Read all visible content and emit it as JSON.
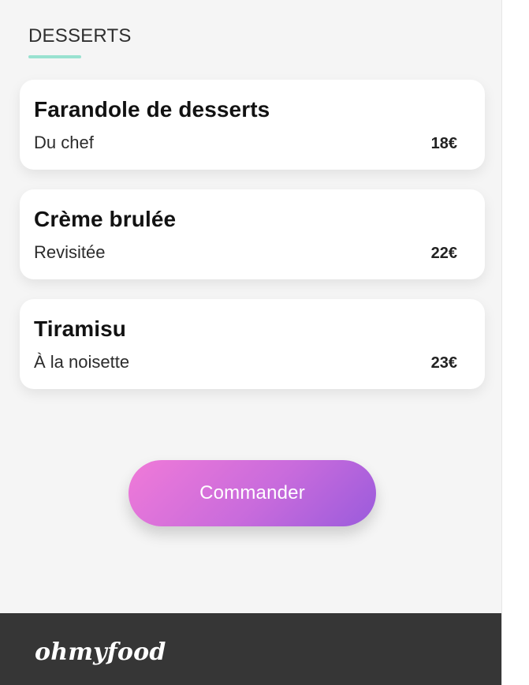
{
  "section": {
    "title": "DESSERTS"
  },
  "items": [
    {
      "name": "Farandole de desserts",
      "subtitle": "Du chef",
      "price": "18€"
    },
    {
      "name": "Crème brulée",
      "subtitle": "Revisitée",
      "price": "22€"
    },
    {
      "name": "Tiramisu",
      "subtitle": "À la noisette",
      "price": "23€"
    }
  ],
  "cta": {
    "label": "Commander"
  },
  "footer": {
    "logo": "ohmyfood"
  },
  "colors": {
    "accent_underline": "#99e2d0",
    "button_gradient_start": "#f07ad8",
    "button_gradient_end": "#9a5bdc",
    "footer_background": "#363636",
    "page_background": "#f5f5f5"
  }
}
